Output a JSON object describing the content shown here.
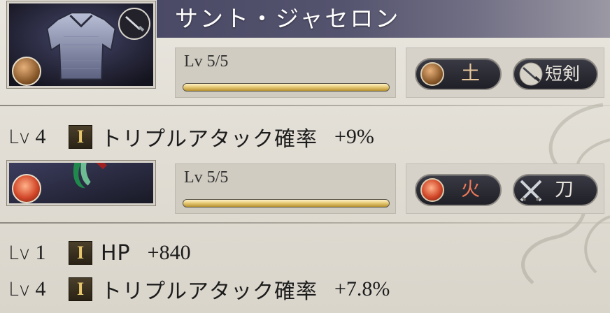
{
  "title": "サント・ジャセロン",
  "items": [
    {
      "level_label": "Lv 5/5",
      "progress": 1.0,
      "element": {
        "label": "土",
        "icon": "earth-element-icon",
        "color": "#8a5a2b"
      },
      "weapon_type": {
        "label": "短剣",
        "icon": "dagger-icon"
      },
      "corner_icon": "dagger-icon",
      "skills": [
        {
          "lv_prefix": "Lv",
          "lv_num": "4",
          "badge": "I",
          "name": "トリプルアタック確率",
          "value": "+9%"
        }
      ]
    },
    {
      "level_label": "Lv 5/5",
      "progress": 1.0,
      "element": {
        "label": "火",
        "icon": "fire-element-icon",
        "color": "#c8401e"
      },
      "weapon_type": {
        "label": "刀",
        "icon": "katana-icon"
      },
      "skills": [
        {
          "lv_prefix": "Lv",
          "lv_num": "1",
          "badge": "I",
          "name": "HP",
          "value": "+840"
        },
        {
          "lv_prefix": "Lv",
          "lv_num": "4",
          "badge": "I",
          "name": "トリプルアタック確率",
          "value": "+7.8%"
        }
      ]
    }
  ]
}
